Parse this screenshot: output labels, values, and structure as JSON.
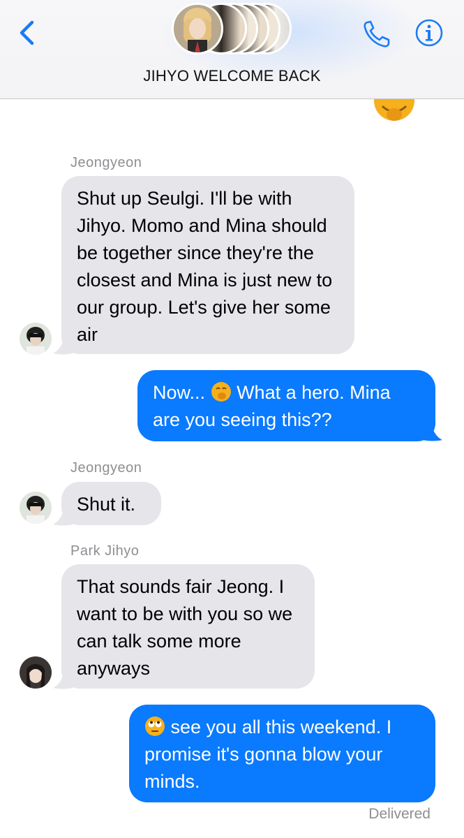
{
  "header": {
    "title": "JIHYO WELCOME BACK",
    "accent": "#1a7cf5"
  },
  "messages": [
    {
      "sender": "Jeongyeon",
      "text": "Shut up Seulgi. I'll be with Jihyo. Momo and Mina should be together since they're the closest and Mina is just new to our group. Let's give her some air",
      "direction": "incoming"
    },
    {
      "text_before_emoji": "Now...",
      "emoji": "shushing-face",
      "text_after_emoji": "What a hero. Mina are you seeing this??",
      "direction": "outgoing"
    },
    {
      "sender": "Jeongyeon",
      "text": "Shut it.",
      "direction": "incoming"
    },
    {
      "sender": "Park Jihyo",
      "text": "That sounds fair Jeong. I want to be with you so we can talk some more anyways",
      "direction": "incoming"
    },
    {
      "emoji": "eye-roll-face",
      "text_after_emoji": "see you all this weekend. I promise it's gonna blow your minds.",
      "direction": "outgoing"
    }
  ],
  "status": "Delivered",
  "colors": {
    "incoming_bubble": "#e5e5ea",
    "outgoing_bubble": "#0a7aff",
    "meta_text": "#8e8e93"
  }
}
